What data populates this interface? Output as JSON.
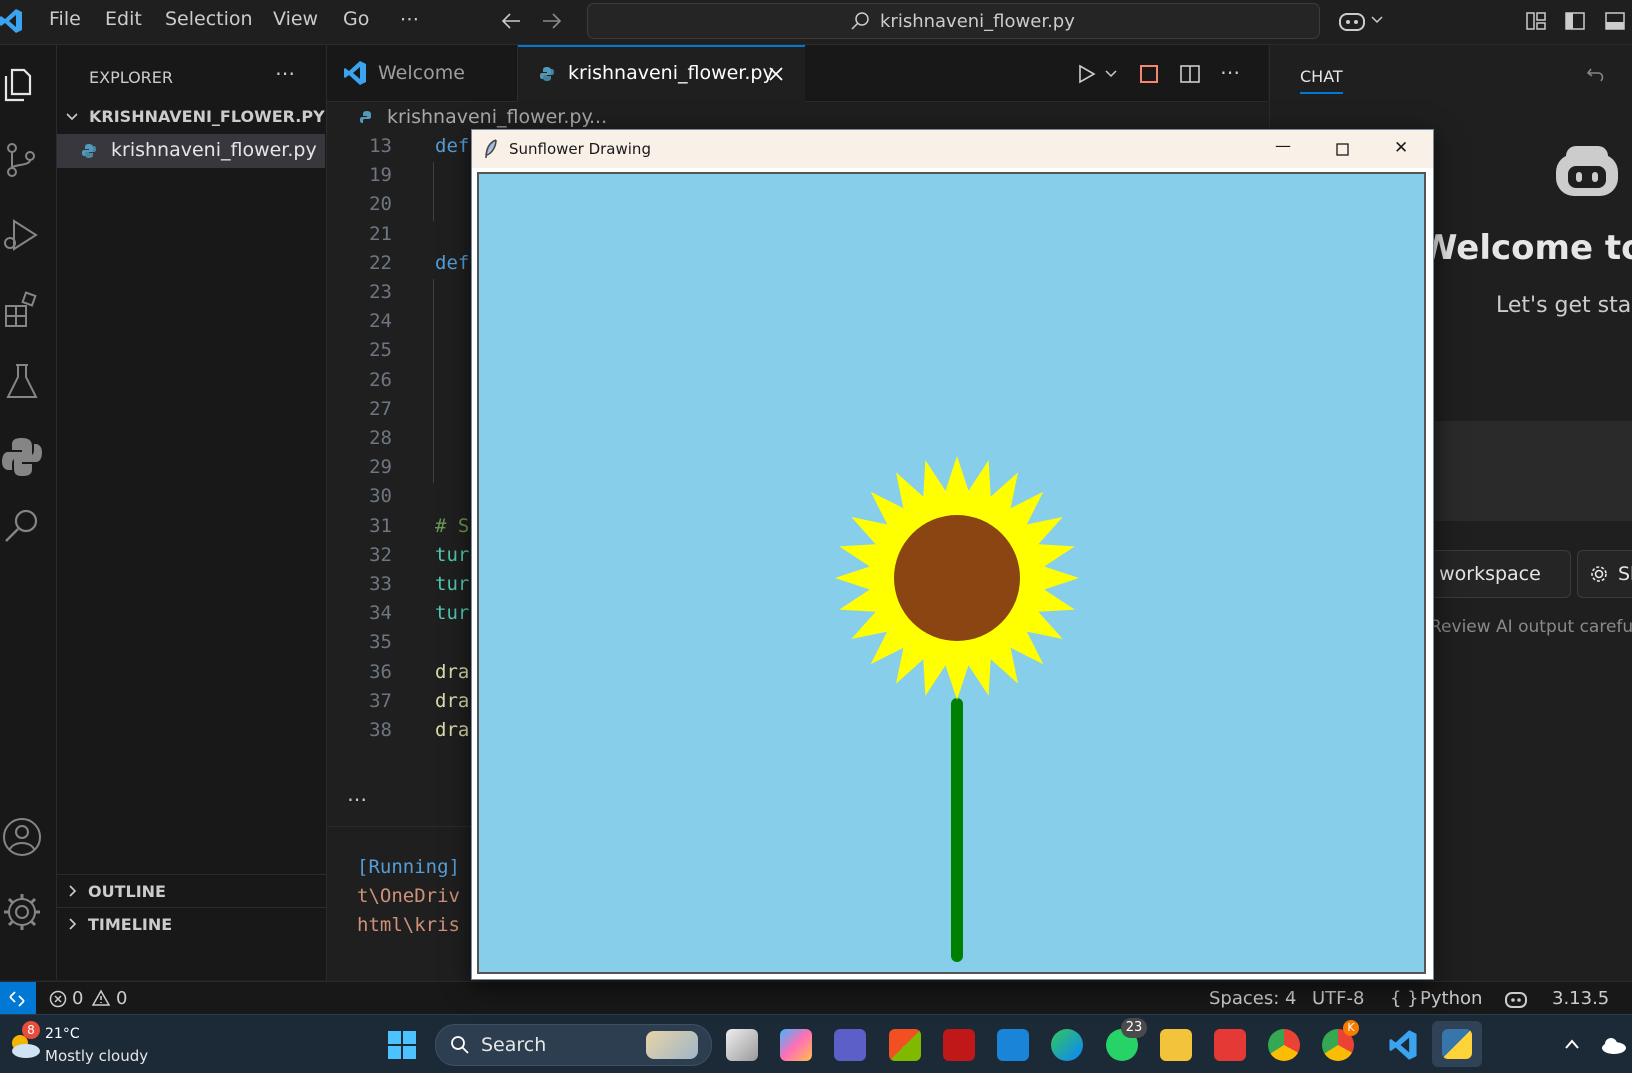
{
  "menu": {
    "items": [
      "File",
      "Edit",
      "Selection",
      "View",
      "Go",
      "⋯"
    ],
    "search_text": "krishnaveni_flower.py"
  },
  "sidebar": {
    "title": "EXPLORER",
    "more": "⋯",
    "folder": "KRISHNAVENI_FLOWER.PY",
    "file": "krishnaveni_flower.py",
    "outline": "OUTLINE",
    "timeline": "TIMELINE"
  },
  "tabs": [
    {
      "label": "Welcome"
    },
    {
      "label": "krishnaveni_flower.py"
    }
  ],
  "breadcrumb": {
    "file": "krishnaveni_flower.py",
    "sep": "...",
    "more": "⋯"
  },
  "code": {
    "lines": [
      {
        "n": "13",
        "t": "def"
      },
      {
        "n": "19",
        "t": ""
      },
      {
        "n": "20",
        "t": ""
      },
      {
        "n": "21",
        "t": ""
      },
      {
        "n": "22",
        "t": "def"
      },
      {
        "n": "23",
        "t": ""
      },
      {
        "n": "24",
        "t": ""
      },
      {
        "n": "25",
        "t": ""
      },
      {
        "n": "26",
        "t": ""
      },
      {
        "n": "27",
        "t": ""
      },
      {
        "n": "28",
        "t": ""
      },
      {
        "n": "29",
        "t": ""
      },
      {
        "n": "30",
        "t": ""
      },
      {
        "n": "31",
        "t": "# S"
      },
      {
        "n": "32",
        "t": "tur"
      },
      {
        "n": "33",
        "t": "tur"
      },
      {
        "n": "34",
        "t": "tur"
      },
      {
        "n": "35",
        "t": ""
      },
      {
        "n": "36",
        "t": "dra"
      },
      {
        "n": "37",
        "t": "dra"
      },
      {
        "n": "38",
        "t": "dra"
      }
    ]
  },
  "panel": {
    "more": "⋯",
    "line1": "[Running]",
    "line2": "t\\OneDriv",
    "line3": "html\\kris"
  },
  "chat": {
    "tab": "CHAT",
    "heading": "Welcome to",
    "subheading": "Let's get star",
    "workspace_btn": "d workspace",
    "sh_btn": "Sh",
    "disclaimer": "Review AI output careful"
  },
  "turtle_window": {
    "title": "Sunflower Drawing",
    "minimize": "—",
    "maximize": "☐",
    "close": "✕",
    "sky_color": "#87ceeb",
    "petal_color": "#ffff00",
    "center_color": "#8b4513",
    "stem_color": "#008000"
  },
  "statusbar": {
    "errors": "0",
    "warnings": "0",
    "spaces": "Spaces: 4",
    "encoding": "UTF-8",
    "language": "Python",
    "lang_icon": "{ }",
    "version": "3.13.5"
  },
  "taskbar": {
    "weather_badge": "8",
    "temperature": "21°C",
    "weather": "Mostly cloudy",
    "search": "Search",
    "whatsapp_badge": "23",
    "chrome_badge": "K"
  }
}
